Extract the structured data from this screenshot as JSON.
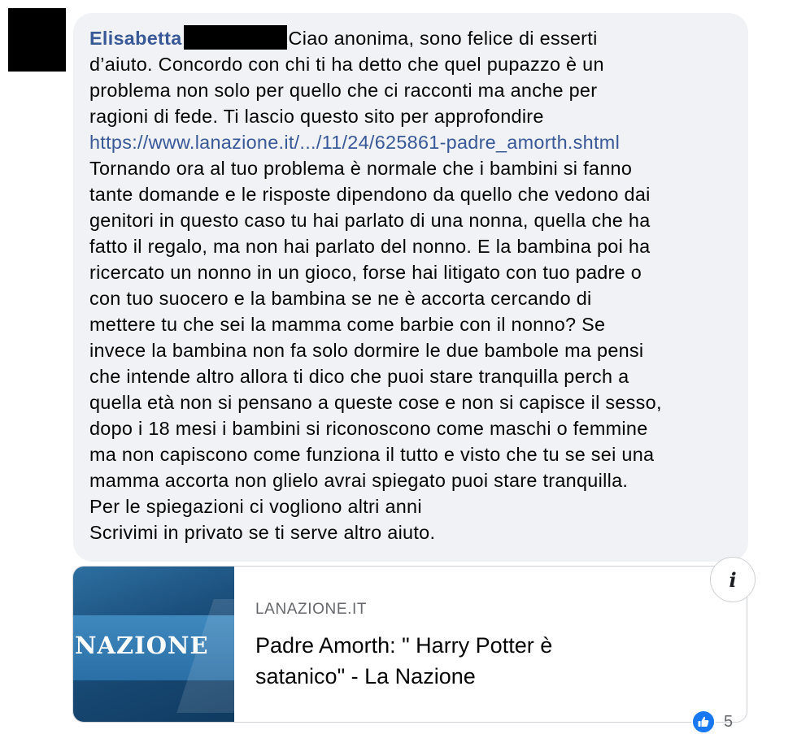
{
  "comment": {
    "author": "Elisabetta",
    "lines": [
      "Ciao anonima, sono felice di esserti",
      "d’aiuto. Concordo con chi ti ha detto che quel pupazzo è un",
      "problema non solo per quello che ci racconti ma anche per",
      "ragioni di fede. Ti lascio questo sito per approfondire",
      "https://www.lanazione.it/.../11/24/625861-padre_amorth.shtml",
      "Tornando ora al tuo problema è normale che i bambini si fanno",
      "tante domande e le risposte dipendono da quello che vedono dai",
      "genitori in questo caso tu hai parlato di una nonna, quella che ha",
      "fatto il regalo, ma non hai parlato del nonno. E la bambina poi ha",
      "ricercato un nonno in un gioco, forse hai litigato con tuo padre o",
      "con tuo suocero e la bambina se ne è accorta cercando di",
      "mettere tu che sei la mamma come barbie con il nonno? Se",
      "invece la bambina non fa solo dormire le due bambole ma pensi",
      "che intende altro allora ti dico che puoi stare tranquilla perch a",
      "quella età non si pensano a queste cose e non si capisce il sesso,",
      "dopo i 18 mesi i bambini si riconoscono come maschi o femmine",
      "ma non capiscono come funziona il tutto e visto che tu se sei una",
      "mamma accorta non glielo avrai spiegato puoi stare tranquilla.",
      "Per le spiegazioni ci vogliono altri anni",
      "Scrivimi in privato se ti serve altro aiuto."
    ]
  },
  "link_preview": {
    "thumbnail_text": "NAZIONE",
    "domain": "LANAZIONE.IT",
    "title_line1": "Padre Amorth: \" Harry Potter è",
    "title_line2": "satanico\" - La Nazione"
  },
  "info_button": {
    "icon": "info-icon",
    "glyph": "i"
  },
  "reactions": {
    "icon": "like-icon",
    "count": "5"
  },
  "colors": {
    "author": "#385898",
    "link": "#385898",
    "bubble": "#f0f2f5",
    "like": "#1877f2"
  }
}
